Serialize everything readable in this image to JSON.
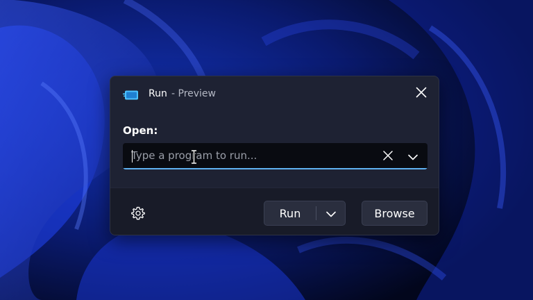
{
  "window": {
    "title": "Run",
    "subtitle": "- Preview",
    "app_icon": "run-app-icon",
    "close_icon": "close-icon"
  },
  "open": {
    "label": "Open:",
    "input_value": "",
    "placeholder": "Type a program to run...",
    "clear_icon": "clear-x-icon",
    "dropdown_icon": "chevron-down-icon"
  },
  "footer": {
    "settings_icon": "gear-icon",
    "run_label": "Run",
    "run_dropdown_icon": "chevron-down-icon",
    "browse_label": "Browse"
  },
  "colors": {
    "accent": "#5fb2f2",
    "dialog_bg": "#1e2233",
    "footer_bg": "#181b28",
    "input_bg": "#090b11",
    "button_bg": "#2a2e3e"
  }
}
